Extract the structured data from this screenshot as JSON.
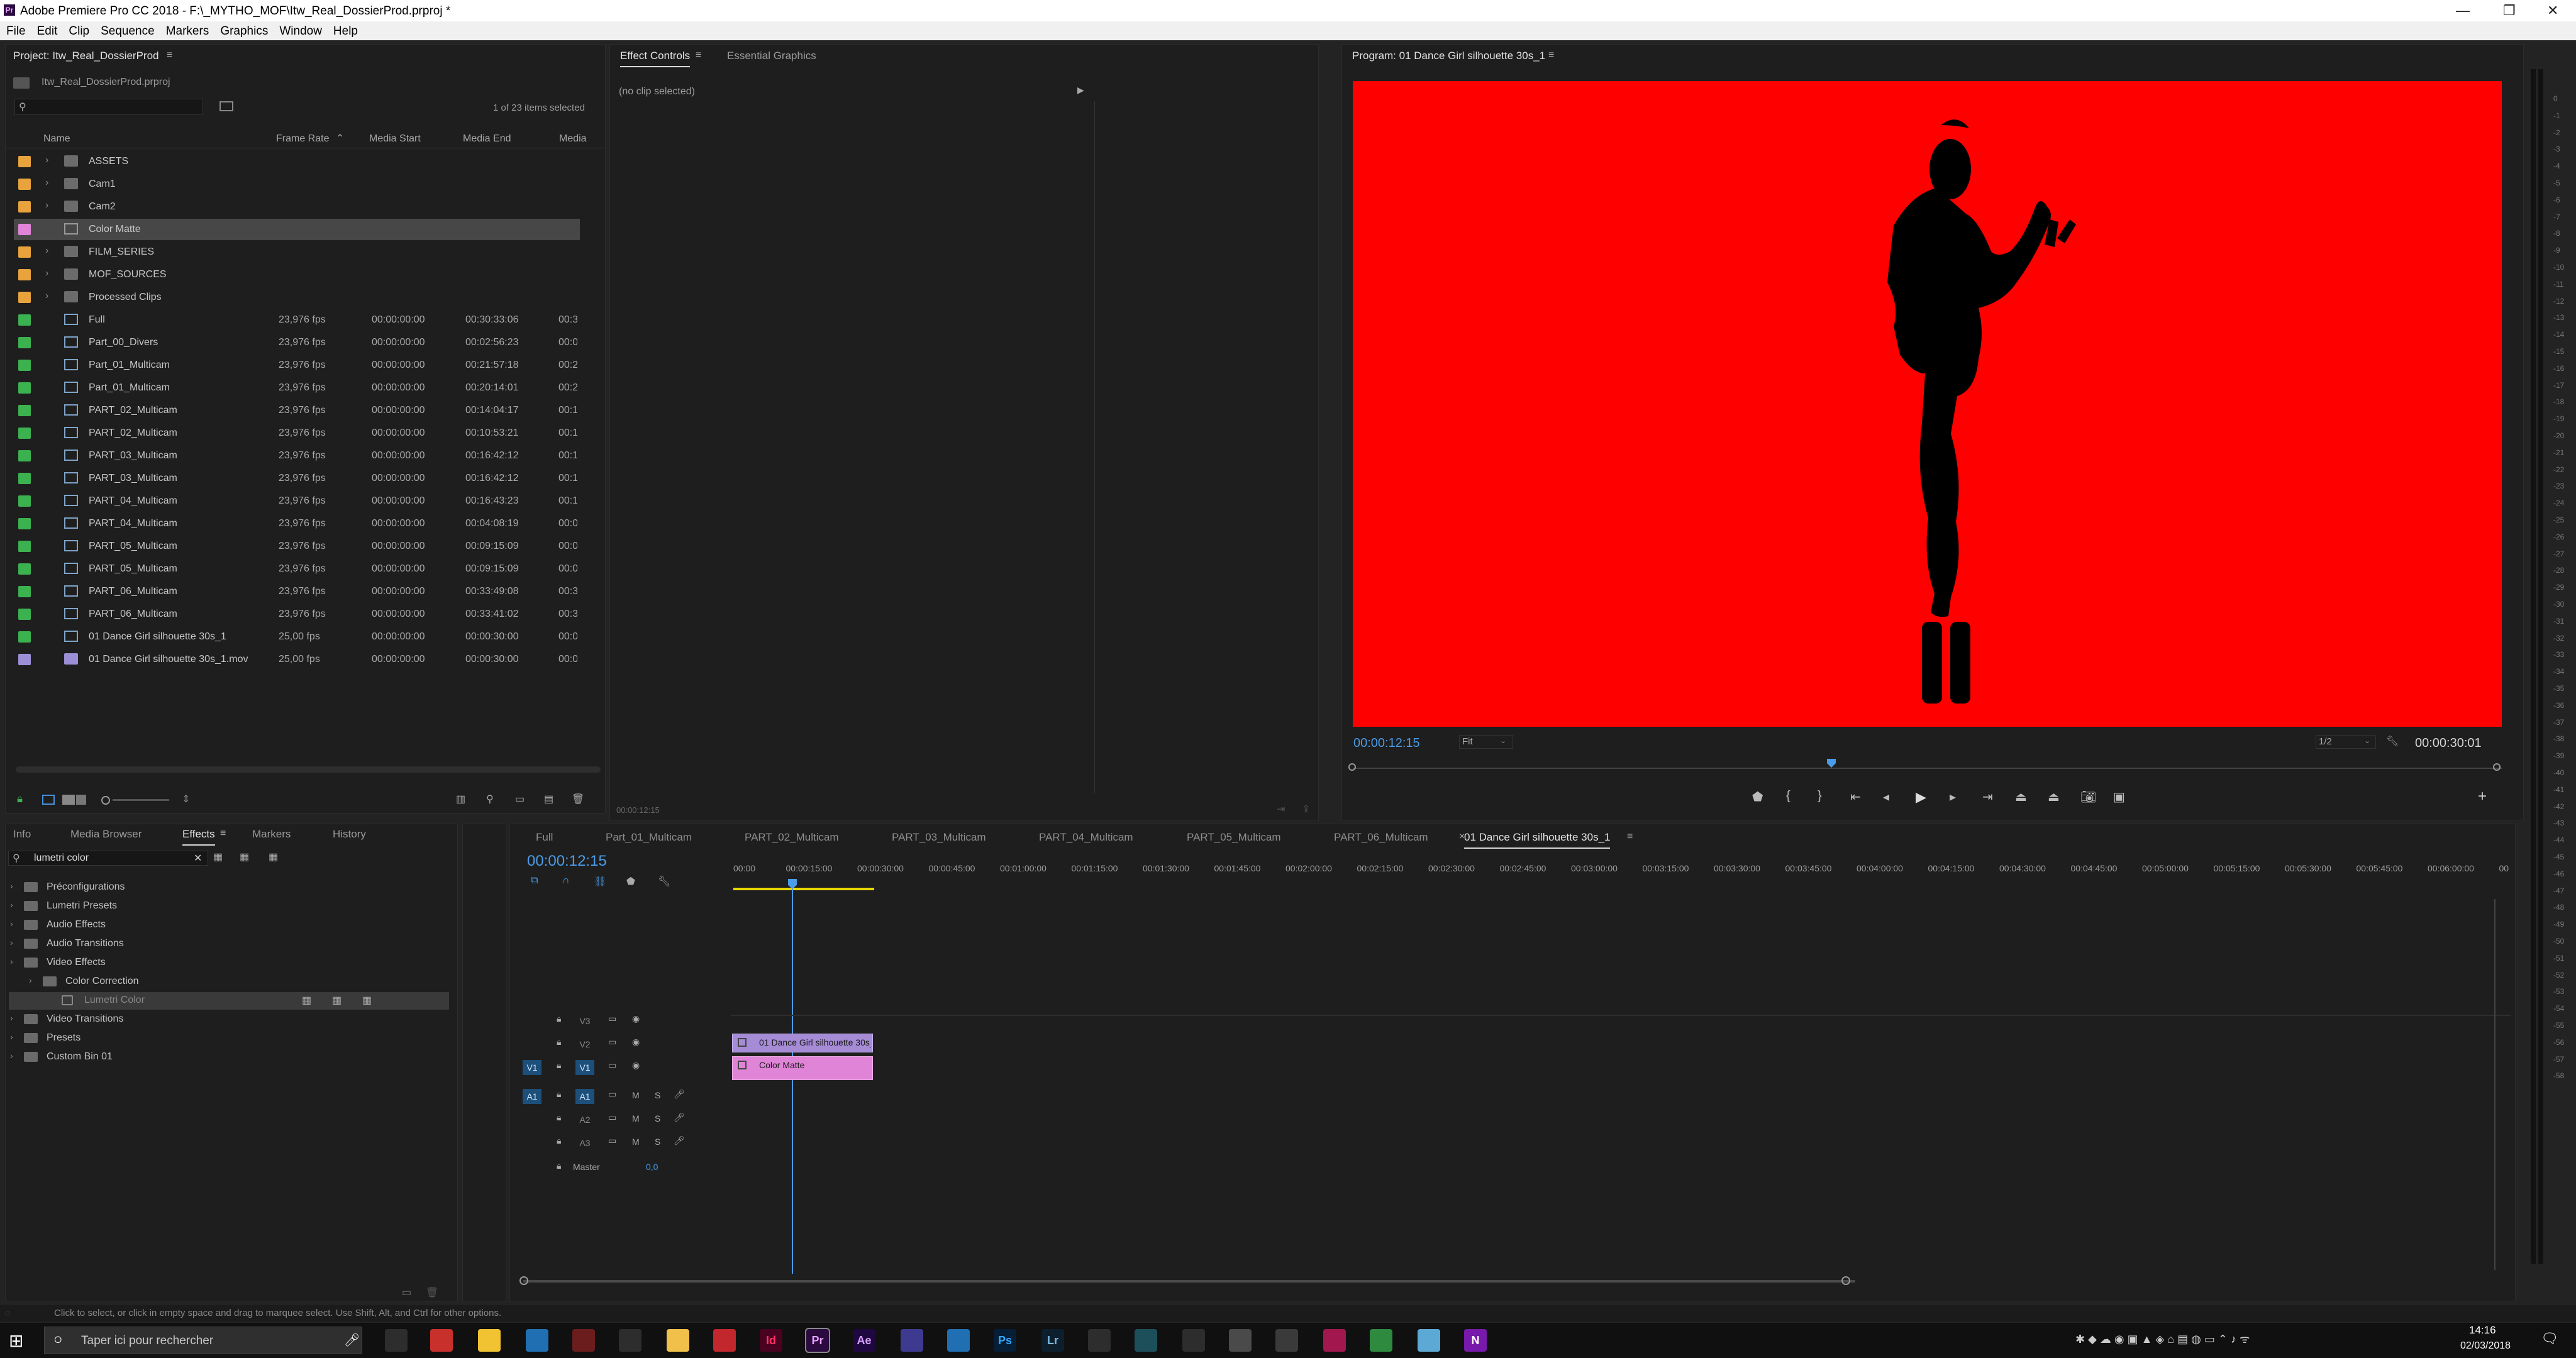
{
  "window": {
    "title": "Adobe Premiere Pro CC 2018 - F:\\_MYTHO_MOF\\Itw_Real_DossierProd.prproj *",
    "minimize": "—",
    "maximize": "❐",
    "close": "✕"
  },
  "menu": [
    "File",
    "Edit",
    "Clip",
    "Sequence",
    "Markers",
    "Graphics",
    "Window",
    "Help"
  ],
  "project": {
    "tab": "Project: Itw_Real_DossierProd",
    "file": "Itw_Real_DossierProd.prproj",
    "search_value": "",
    "count": "1 of 23 items selected",
    "columns": [
      "Name",
      "Frame Rate",
      "Media Start",
      "Media End",
      "Media"
    ],
    "items": [
      {
        "name": "ASSETS",
        "type": "folder",
        "color": "#e8a33c",
        "rate": "",
        "start": "",
        "end": "",
        "more": ""
      },
      {
        "name": "Cam1",
        "type": "folder",
        "color": "#e8a33c",
        "rate": "",
        "start": "",
        "end": "",
        "more": ""
      },
      {
        "name": "Cam2",
        "type": "folder",
        "color": "#e8a33c",
        "rate": "",
        "start": "",
        "end": "",
        "more": ""
      },
      {
        "name": "Color Matte",
        "type": "matte",
        "color": "#e084d8",
        "rate": "",
        "start": "",
        "end": "",
        "more": ""
      },
      {
        "name": "FILM_SERIES",
        "type": "folder",
        "color": "#e8a33c",
        "rate": "",
        "start": "",
        "end": "",
        "more": ""
      },
      {
        "name": "MOF_SOURCES",
        "type": "folder",
        "color": "#e8a33c",
        "rate": "",
        "start": "",
        "end": "",
        "more": ""
      },
      {
        "name": "Processed Clips",
        "type": "folder",
        "color": "#e8a33c",
        "rate": "",
        "start": "",
        "end": "",
        "more": ""
      },
      {
        "name": "Full",
        "type": "seq",
        "color": "#3cb150",
        "rate": "23,976 fps",
        "start": "00:00:00:00",
        "end": "00:30:33:06",
        "more": "00:3"
      },
      {
        "name": "Part_00_Divers",
        "type": "seq",
        "color": "#3cb150",
        "rate": "23,976 fps",
        "start": "00:00:00:00",
        "end": "00:02:56:23",
        "more": "00:0"
      },
      {
        "name": "Part_01_Multicam",
        "type": "seq",
        "color": "#3cb150",
        "rate": "23,976 fps",
        "start": "00:00:00:00",
        "end": "00:21:57:18",
        "more": "00:2"
      },
      {
        "name": "Part_01_Multicam",
        "type": "seq",
        "color": "#3cb150",
        "rate": "23,976 fps",
        "start": "00:00:00:00",
        "end": "00:20:14:01",
        "more": "00:2"
      },
      {
        "name": "PART_02_Multicam",
        "type": "seq",
        "color": "#3cb150",
        "rate": "23,976 fps",
        "start": "00:00:00:00",
        "end": "00:14:04:17",
        "more": "00:1"
      },
      {
        "name": "PART_02_Multicam",
        "type": "seq",
        "color": "#3cb150",
        "rate": "23,976 fps",
        "start": "00:00:00:00",
        "end": "00:10:53:21",
        "more": "00:1"
      },
      {
        "name": "PART_03_Multicam",
        "type": "seq",
        "color": "#3cb150",
        "rate": "23,976 fps",
        "start": "00:00:00:00",
        "end": "00:16:42:12",
        "more": "00:1"
      },
      {
        "name": "PART_03_Multicam",
        "type": "seq",
        "color": "#3cb150",
        "rate": "23,976 fps",
        "start": "00:00:00:00",
        "end": "00:16:42:12",
        "more": "00:1"
      },
      {
        "name": "PART_04_Multicam",
        "type": "seq",
        "color": "#3cb150",
        "rate": "23,976 fps",
        "start": "00:00:00:00",
        "end": "00:16:43:23",
        "more": "00:1"
      },
      {
        "name": "PART_04_Multicam",
        "type": "seq",
        "color": "#3cb150",
        "rate": "23,976 fps",
        "start": "00:00:00:00",
        "end": "00:04:08:19",
        "more": "00:0"
      },
      {
        "name": "PART_05_Multicam",
        "type": "seq",
        "color": "#3cb150",
        "rate": "23,976 fps",
        "start": "00:00:00:00",
        "end": "00:09:15:09",
        "more": "00:0"
      },
      {
        "name": "PART_05_Multicam",
        "type": "seq",
        "color": "#3cb150",
        "rate": "23,976 fps",
        "start": "00:00:00:00",
        "end": "00:09:15:09",
        "more": "00:0"
      },
      {
        "name": "PART_06_Multicam",
        "type": "seq",
        "color": "#3cb150",
        "rate": "23,976 fps",
        "start": "00:00:00:00",
        "end": "00:33:49:08",
        "more": "00:3"
      },
      {
        "name": "PART_06_Multicam",
        "type": "seq",
        "color": "#3cb150",
        "rate": "23,976 fps",
        "start": "00:00:00:00",
        "end": "00:33:41:02",
        "more": "00:3"
      },
      {
        "name": "01 Dance Girl silhouette 30s_1",
        "type": "seq",
        "color": "#3cb150",
        "rate": "25,00 fps",
        "start": "00:00:00:00",
        "end": "00:00:30:00",
        "more": "00:0"
      },
      {
        "name": "01 Dance Girl silhouette 30s_1.mov",
        "type": "clip",
        "color": "#9c8fd6",
        "rate": "25,00 fps",
        "start": "00:00:00:00",
        "end": "00:00:30:00",
        "more": "00:0"
      }
    ]
  },
  "effect_controls": {
    "tabs": [
      "Effect Controls",
      "Essential Graphics"
    ],
    "empty": "(no clip selected)",
    "time": "00:00:12:15"
  },
  "program": {
    "tab": "Program: 01 Dance Girl silhouette 30s_1",
    "timecode": "00:00:12:15",
    "fit": "Fit",
    "resolution": "1/2",
    "duration": "00:00:30:01",
    "bg_color": "#ff0000"
  },
  "effects": {
    "tabs": [
      "Info",
      "Media Browser",
      "Effects",
      "Markers",
      "History"
    ],
    "search_value": "lumetri color",
    "tree": [
      {
        "label": "Préconfigurations",
        "depth": 0
      },
      {
        "label": "Lumetri Presets",
        "depth": 0
      },
      {
        "label": "Audio Effects",
        "depth": 0
      },
      {
        "label": "Audio Transitions",
        "depth": 0
      },
      {
        "label": "Video Effects",
        "depth": 0
      },
      {
        "label": "Color Correction",
        "depth": 1
      },
      {
        "label": "Lumetri Color",
        "depth": 2
      },
      {
        "label": "Video Transitions",
        "depth": 0
      },
      {
        "label": "Presets",
        "depth": 0
      },
      {
        "label": "Custom Bin 01",
        "depth": 0
      }
    ]
  },
  "timeline": {
    "tabs": [
      "Full",
      "Part_01_Multicam",
      "PART_02_Multicam",
      "PART_03_Multicam",
      "PART_04_Multicam",
      "PART_05_Multicam",
      "PART_06_Multicam",
      "01 Dance Girl silhouette 30s_1"
    ],
    "timecode": "00:00:12:15",
    "ruler": [
      "00:00",
      "00:00:15:00",
      "00:00:30:00",
      "00:00:45:00",
      "00:01:00:00",
      "00:01:15:00",
      "00:01:30:00",
      "00:01:45:00",
      "00:02:00:00",
      "00:02:15:00",
      "00:02:30:00",
      "00:02:45:00",
      "00:03:00:00",
      "00:03:15:00",
      "00:03:30:00",
      "00:03:45:00",
      "00:04:00:00",
      "00:04:15:00",
      "00:04:30:00",
      "00:04:45:00",
      "00:05:00:00",
      "00:05:15:00",
      "00:05:30:00",
      "00:05:45:00",
      "00:06:00:00",
      "00"
    ],
    "video_tracks": [
      "V3",
      "V2",
      "V1"
    ],
    "audio_tracks": [
      "A1",
      "A2",
      "A3"
    ],
    "src_v": "V1",
    "src_a": "A1",
    "master": "Master",
    "master_value": "0,0",
    "m": "M",
    "s": "S",
    "clip_v2": "01 Dance Girl silhouette 30s_1",
    "clip_v1": "Color Matte"
  },
  "meter_scale": [
    "0",
    "-1",
    "-2",
    "-3",
    "-4",
    "-5",
    "-6",
    "-7",
    "-8",
    "-9",
    "-10",
    "-11",
    "-12",
    "-13",
    "-14",
    "-15",
    "-16",
    "-17",
    "-18",
    "-19",
    "-20",
    "-21",
    "-22",
    "-23",
    "-24",
    "-25",
    "-26",
    "-27",
    "-28",
    "-29",
    "-30",
    "-31",
    "-32",
    "-33",
    "-34",
    "-35",
    "-36",
    "-37",
    "-38",
    "-39",
    "-40",
    "-41",
    "-42",
    "-43",
    "-44",
    "-45",
    "-46",
    "-47",
    "-48",
    "-49",
    "-50",
    "-51",
    "-52",
    "-53",
    "-54",
    "-55",
    "-56",
    "-57",
    "-58"
  ],
  "status": "Click to select, or click in empty space and drag to marquee select. Use Shift, Alt, and Ctrl for other options.",
  "taskbar": {
    "search_placeholder": "Taper ici pour rechercher",
    "time": "14:16",
    "date": "02/03/2018",
    "apps": [
      {
        "label": "",
        "color": "#2d2d2d",
        "fg": "#ffffff",
        "name": "task-view-icon"
      },
      {
        "label": "",
        "color": "#c8302c",
        "fg": "#ffffff",
        "name": "app-red-icon"
      },
      {
        "label": "",
        "color": "#f1c232",
        "fg": "#000000",
        "name": "store-icon"
      },
      {
        "label": "",
        "color": "#1f6fb2",
        "fg": "#ffffff",
        "name": "app-blue-icon"
      },
      {
        "label": "",
        "color": "#6b1d1d",
        "fg": "#ffffff",
        "name": "app-dark-red-icon"
      },
      {
        "label": "",
        "color": "#2d2d2d",
        "fg": "#ffffff",
        "name": "app-grid-icon"
      },
      {
        "label": "",
        "color": "#f0c04a",
        "fg": "#000000",
        "name": "file-explorer-icon"
      },
      {
        "label": "",
        "color": "#c1272d",
        "fg": "#ffffff",
        "name": "filezilla-icon"
      },
      {
        "label": "Id",
        "color": "#49021f",
        "fg": "#ff3366",
        "name": "indesign-icon"
      },
      {
        "label": "Pr",
        "color": "#2a0a3f",
        "fg": "#e5a0ff",
        "name": "premiere-icon"
      },
      {
        "label": "Ae",
        "color": "#1f0740",
        "fg": "#d8a0ff",
        "name": "after-effects-icon"
      },
      {
        "label": "",
        "color": "#3e3a8f",
        "fg": "#ffffff",
        "name": "media-encoder-icon"
      },
      {
        "label": "",
        "color": "#1f6fb2",
        "fg": "#ffffff",
        "name": "app-outline-icon"
      },
      {
        "label": "Ps",
        "color": "#061e36",
        "fg": "#31a8ff",
        "name": "photoshop-icon"
      },
      {
        "label": "Lr",
        "color": "#0d1f2d",
        "fg": "#79b8e0",
        "name": "lightroom-icon"
      },
      {
        "label": "",
        "color": "#2d2d2d",
        "fg": "#ffffff",
        "name": "app-circle-icon"
      },
      {
        "label": "",
        "color": "#1d4f5a",
        "fg": "#ffffff",
        "name": "app-teal-icon"
      },
      {
        "label": "",
        "color": "#2d2d2d",
        "fg": "#ffffff",
        "name": "davinci-icon"
      },
      {
        "label": "",
        "color": "#4a4a4a",
        "fg": "#ffffff",
        "name": "app-gray-icon"
      },
      {
        "label": "",
        "color": "#3a3a3a",
        "fg": "#ffffff",
        "name": "app-wheel-icon"
      },
      {
        "label": "",
        "color": "#a1174e",
        "fg": "#ffffff",
        "name": "app-magenta-icon"
      },
      {
        "label": "",
        "color": "#2d8a3f",
        "fg": "#ffffff",
        "name": "chrome-icon"
      },
      {
        "label": "",
        "color": "#5da9d6",
        "fg": "#ffffff",
        "name": "app-light-blue-icon"
      },
      {
        "label": "N",
        "color": "#7719aa",
        "fg": "#ffffff",
        "name": "onenote-icon"
      }
    ]
  }
}
